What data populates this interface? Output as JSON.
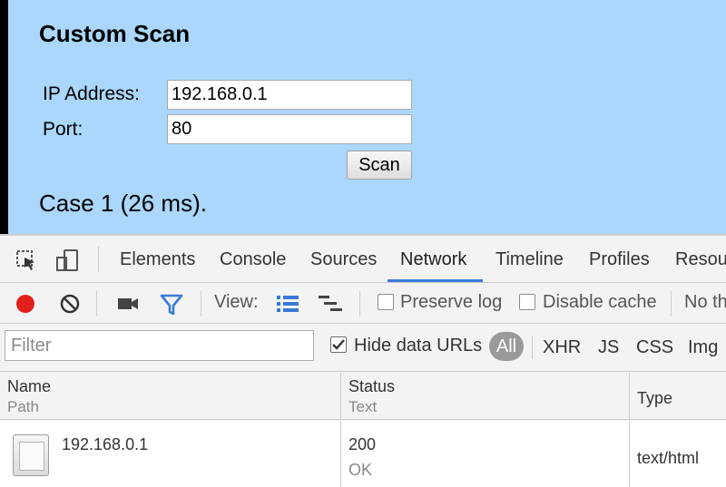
{
  "page": {
    "title": "Custom Scan",
    "ip_label": "IP Address:",
    "ip_value": "192.168.0.1",
    "port_label": "Port:",
    "port_value": "80",
    "scan_button": "Scan",
    "result": "Case 1 (26 ms)."
  },
  "devtools": {
    "icons": {
      "inspect": "cursor-select-icon",
      "device": "device-mode-icon"
    },
    "tabs": [
      "Elements",
      "Console",
      "Sources",
      "Network",
      "Timeline",
      "Profiles",
      "Resou"
    ],
    "active_tab": "Network",
    "toolbar": {
      "record_color": "#e0201b",
      "filter_color": "#3879d9",
      "view_label": "View:",
      "preserve_log": "Preserve log",
      "disable_cache": "Disable cache",
      "no_throttle": "No th"
    },
    "filter": {
      "placeholder": "Filter",
      "hide_data_urls": "Hide data URLs",
      "hide_data_urls_checked": true,
      "types": [
        "All",
        "XHR",
        "JS",
        "CSS",
        "Img"
      ],
      "active_type": "All"
    },
    "table": {
      "headers": [
        {
          "main": "Name",
          "sub": "Path"
        },
        {
          "main": "Status",
          "sub": "Text"
        },
        {
          "main": "Type",
          "sub": ""
        }
      ],
      "rows": [
        {
          "name": "192.168.0.1",
          "status": "200",
          "status_text": "OK",
          "type": "text/html"
        }
      ]
    },
    "accent": "#3879d9"
  }
}
